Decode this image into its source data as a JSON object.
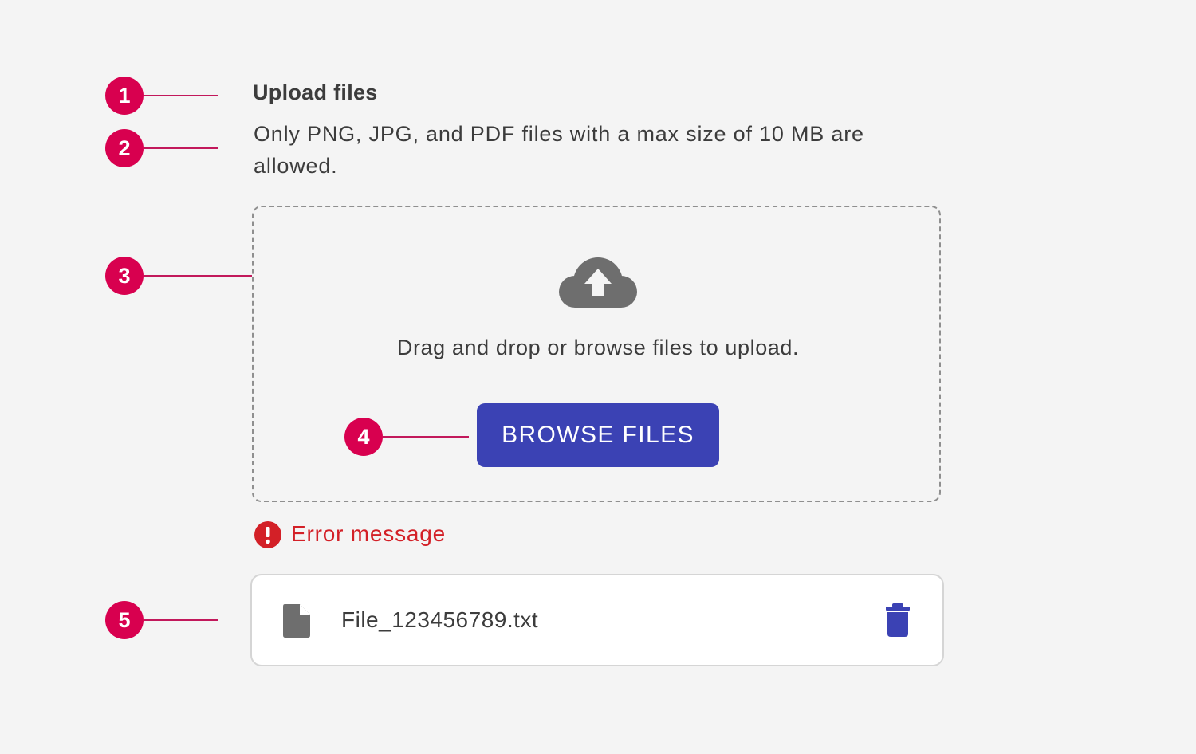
{
  "annotations": {
    "markers": [
      "1",
      "2",
      "3",
      "4",
      "5"
    ],
    "marker_color": "#d8004f"
  },
  "uploader": {
    "title": "Upload files",
    "description": "Only PNG, JPG, and PDF files with a max size of 10 MB are allowed.",
    "dropzone": {
      "icon": "cloud-upload-icon",
      "instruction": "Drag and drop or browse files to upload.",
      "browse_label": "BROWSE FILES"
    },
    "error": {
      "icon": "error-icon",
      "message": "Error message",
      "color": "#d32027"
    },
    "file": {
      "icon": "file-icon",
      "name": "File_123456789.txt",
      "delete_icon": "trash-icon"
    },
    "accent_color": "#3b42b4"
  }
}
